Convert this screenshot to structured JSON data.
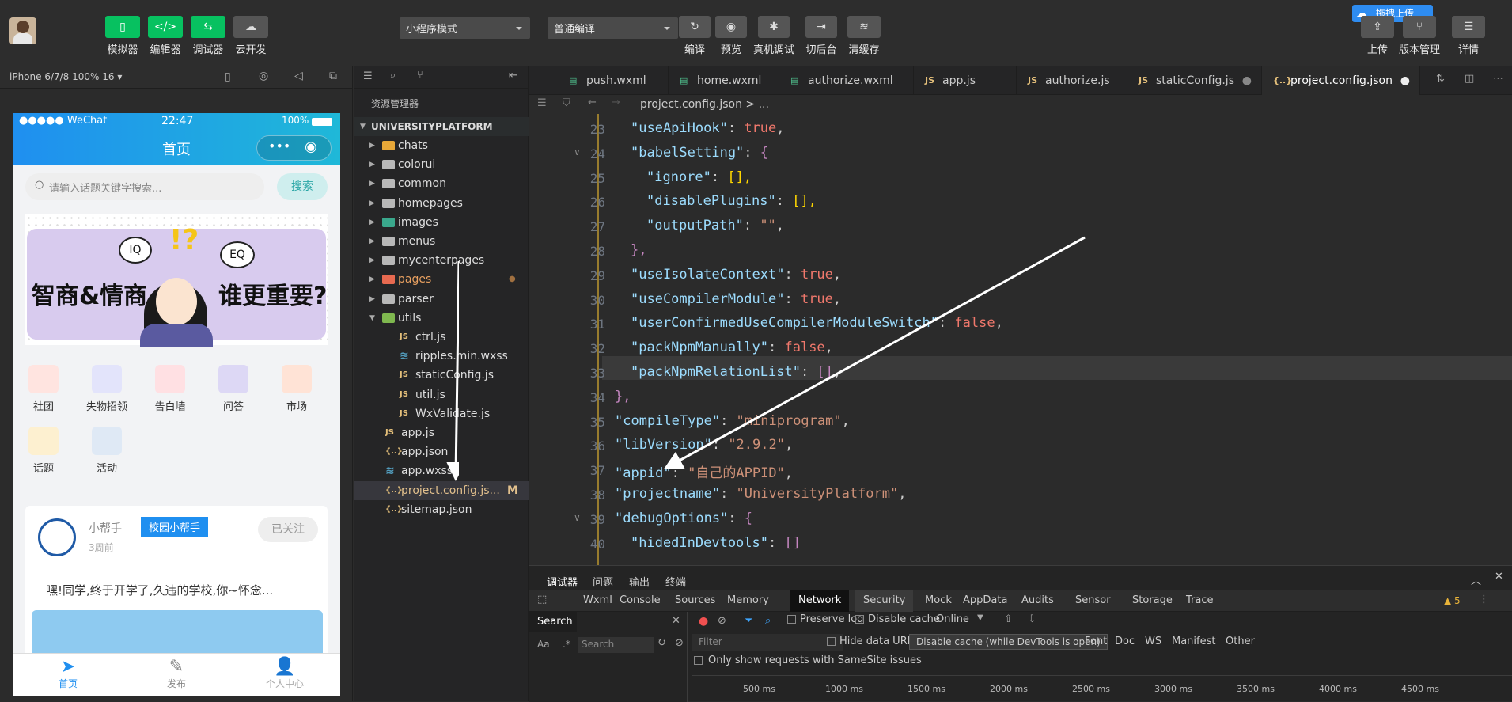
{
  "toolbar": {
    "buttons": [
      {
        "label": "模拟器"
      },
      {
        "label": "编辑器"
      },
      {
        "label": "调试器"
      },
      {
        "label": "云开发"
      }
    ],
    "mode_select": "小程序模式",
    "compile_select": "普通编译",
    "actions": [
      {
        "label": "编译"
      },
      {
        "label": "预览"
      },
      {
        "label": "真机调试"
      },
      {
        "label": "切后台"
      },
      {
        "label": "清缓存"
      }
    ],
    "drag_upload": "拖拽上传",
    "right": [
      {
        "label": "上传"
      },
      {
        "label": "版本管理"
      },
      {
        "label": "详情"
      }
    ]
  },
  "simulator": {
    "device": "iPhone 6/7/8 100% 16 ▾",
    "status": {
      "carrier": "●●●●● WeChat",
      "time": "22:47",
      "battery": "100%"
    },
    "nav_title": "首页",
    "search_placeholder": "请输入话题关键字搜索...",
    "search_button": "搜索",
    "banner": {
      "left": "智商&情商",
      "right": "谁更重要?",
      "iq": "IQ",
      "eq": "EQ"
    },
    "grid": [
      {
        "label": "社团"
      },
      {
        "label": "失物招领"
      },
      {
        "label": "告白墙"
      },
      {
        "label": "问答"
      },
      {
        "label": "市场"
      },
      {
        "label": "话题"
      },
      {
        "label": "活动"
      }
    ],
    "post": {
      "author": "小帮手",
      "tag": "校园小帮手",
      "time": "3周前",
      "follow": "已关注",
      "text": "嘿!同学,终于开学了,久违的学校,你~怀念..."
    },
    "tabbar": [
      {
        "label": "首页"
      },
      {
        "label": "发布"
      },
      {
        "label": "个人中心"
      }
    ]
  },
  "explorer": {
    "title": "资源管理器",
    "root": "UNIVERSITYPLATFORM",
    "items": [
      {
        "label": "chats"
      },
      {
        "label": "colorui"
      },
      {
        "label": "common"
      },
      {
        "label": "homepages"
      },
      {
        "label": "images"
      },
      {
        "label": "menus"
      },
      {
        "label": "mycenterpages"
      },
      {
        "label": "pages"
      },
      {
        "label": "parser"
      },
      {
        "label": "utils"
      },
      {
        "label": "ctrl.js"
      },
      {
        "label": "ripples.min.wxss"
      },
      {
        "label": "staticConfig.js"
      },
      {
        "label": "util.js"
      },
      {
        "label": "WxValidate.js"
      },
      {
        "label": "app.js"
      },
      {
        "label": "app.json"
      },
      {
        "label": "app.wxss"
      },
      {
        "label": "project.config.js..."
      },
      {
        "label": "sitemap.json"
      }
    ],
    "modified_badge": "M"
  },
  "tabs": [
    {
      "label": "push.wxml"
    },
    {
      "label": "home.wxml"
    },
    {
      "label": "authorize.wxml"
    },
    {
      "label": "app.js"
    },
    {
      "label": "authorize.js"
    },
    {
      "label": "staticConfig.js"
    },
    {
      "label": "project.config.json"
    }
  ],
  "breadcrumb": "project.config.json > ...",
  "code_lines": [
    {
      "n": "23",
      "k": "\"useApiHook\"",
      "v": "true"
    },
    {
      "n": "24",
      "k": "\"babelSetting\"",
      "v": "{"
    },
    {
      "n": "25",
      "k": "\"ignore\"",
      "v": "[],"
    },
    {
      "n": "26",
      "k": "\"disablePlugins\"",
      "v": "[],"
    },
    {
      "n": "27",
      "k": "\"outputPath\"",
      "v": "\"\""
    },
    {
      "n": "28",
      "t": "},"
    },
    {
      "n": "29",
      "k": "\"useIsolateContext\"",
      "v": "true"
    },
    {
      "n": "30",
      "k": "\"useCompilerModule\"",
      "v": "true"
    },
    {
      "n": "31",
      "k": "\"userConfirmedUseCompilerModuleSwitch\"",
      "v": "false"
    },
    {
      "n": "32",
      "k": "\"packNpmManually\"",
      "v": "false"
    },
    {
      "n": "33",
      "k": "\"packNpmRelationList\"",
      "v": "[]"
    },
    {
      "n": "34",
      "t": "},"
    },
    {
      "n": "35",
      "k": "\"compileType\"",
      "v": "\"miniprogram\""
    },
    {
      "n": "36",
      "k": "\"libVersion\"",
      "v": "\"2.9.2\""
    },
    {
      "n": "37",
      "k": "\"appid\"",
      "v": "\"自己的APPID\""
    },
    {
      "n": "38",
      "k": "\"projectname\"",
      "v": "\"UniversityPlatform\""
    },
    {
      "n": "39",
      "k": "\"debugOptions\"",
      "v": "{"
    },
    {
      "n": "40",
      "k": "\"hidedInDevtools\"",
      "v": "[]"
    }
  ],
  "devtools": {
    "top_tabs": [
      {
        "label": "调试器"
      },
      {
        "label": "问题"
      },
      {
        "label": "输出"
      },
      {
        "label": "终端"
      }
    ],
    "panel_tabs": [
      {
        "label": "Wxml"
      },
      {
        "label": "Console"
      },
      {
        "label": "Sources"
      },
      {
        "label": "Memory"
      },
      {
        "label": "Network"
      },
      {
        "label": "Security"
      },
      {
        "label": "Mock"
      },
      {
        "label": "AppData"
      },
      {
        "label": "Audits"
      },
      {
        "label": "Sensor"
      },
      {
        "label": "Storage"
      },
      {
        "label": "Trace"
      }
    ],
    "warnings": "▲ 5",
    "search_title": "Search",
    "search_placeholder": "Search",
    "preserve_log": "Preserve log",
    "disable_cache": "Disable cache",
    "online": "Online",
    "filter_placeholder": "Filter",
    "hide_data_urls": "Hide data URLs",
    "tooltip": "Disable cache (while DevTools is open)",
    "types": [
      {
        "label": "Font"
      },
      {
        "label": "Doc"
      },
      {
        "label": "WS"
      },
      {
        "label": "Manifest"
      },
      {
        "label": "Other"
      }
    ],
    "samesite": "Only show requests with SameSite issues",
    "ticks": [
      "500 ms",
      "1000 ms",
      "1500 ms",
      "2000 ms",
      "2500 ms",
      "3000 ms",
      "3500 ms",
      "4000 ms",
      "4500 ms"
    ]
  },
  "colors": {
    "accent": "#07c160",
    "nav_blue": "#1f8ff0",
    "code_key": "#9cdcfe",
    "code_string": "#ce9178"
  }
}
